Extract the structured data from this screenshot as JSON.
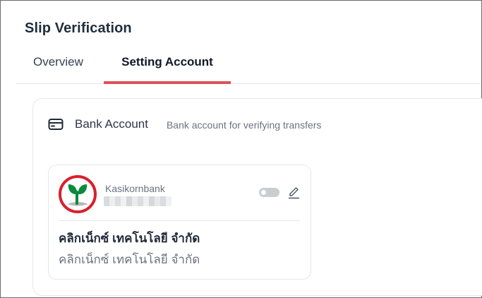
{
  "page": {
    "title": "Slip Verification"
  },
  "tabs": [
    {
      "label": "Overview",
      "active": false
    },
    {
      "label": "Setting Account",
      "active": true
    }
  ],
  "bank_account_section": {
    "icon": "credit-card-icon",
    "title": "Bank Account",
    "subtitle": "Bank account for verifying transfers"
  },
  "accounts": [
    {
      "bank_name": "Kasikornbank",
      "bank_logo": "kasikornbank-logo",
      "account_number": "●●● ●●●",
      "enabled": false,
      "account_name": "คลิกเน็กซ์ เทคโนโลยี จำกัด",
      "account_name_secondary": "คลิกเน็กซ์ เทคโนโลยี จำกัด"
    }
  ],
  "colors": {
    "accent": "#d9535b",
    "kbank_green": "#0a8a3c",
    "kbank_red": "#d8202c"
  }
}
